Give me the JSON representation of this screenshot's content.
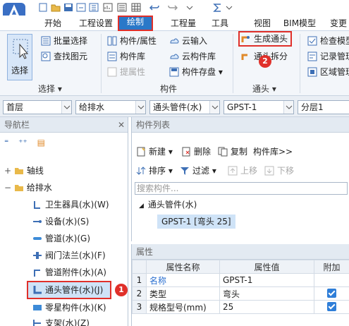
{
  "tabs": [
    {
      "label": "开始"
    },
    {
      "label": "工程设置"
    },
    {
      "label": "绘制",
      "active": true
    },
    {
      "label": "工程量"
    },
    {
      "label": "工具"
    },
    {
      "label": "视图"
    },
    {
      "label": "BIM模型"
    },
    {
      "label": "变更"
    }
  ],
  "ribbon": {
    "select_label": "选择",
    "batch_select": "批量选择",
    "find_element": "查找图元",
    "group_select": "选择",
    "component_attr": "构件/属性",
    "component_lib": "构件库",
    "extract_attr": "提属性",
    "cloud_input": "云输入",
    "cloud_lib": "云构件库",
    "component_save": "构件存盘",
    "group_component": "构件",
    "generate_fitting": "生成通头",
    "fitting_split": "通头拆分",
    "group_fitting": "通头",
    "check_model": "检查模型",
    "record_manage": "记录管理",
    "area_manage": "区域管理"
  },
  "dropdowns": {
    "floor": "首层",
    "discipline": "给排水",
    "type": "通头管件(水)",
    "component": "GPST-1",
    "layer": "分层1"
  },
  "nav": {
    "title": "导航栏",
    "axis": "轴线",
    "water": "给排水",
    "items": [
      {
        "label": "卫生器具(水)(W)"
      },
      {
        "label": "设备(水)(S)"
      },
      {
        "label": "管道(水)(G)"
      },
      {
        "label": "阀门法兰(水)(F)"
      },
      {
        "label": "管道附件(水)(A)"
      },
      {
        "label": "通头管件(水)(J)"
      },
      {
        "label": "零星构件(水)(K)"
      },
      {
        "label": "支架(水)(Z)"
      }
    ]
  },
  "list": {
    "title": "构件列表",
    "new": "新建",
    "delete": "删除",
    "copy": "复制",
    "library": "构件库>>",
    "sort": "排序",
    "filter": "过滤",
    "up": "上移",
    "down": "下移",
    "search_placeholder": "搜索构件...",
    "group": "通头管件(水)",
    "selected_item": "GPST-1 [弯头 25]"
  },
  "props": {
    "title": "属性",
    "col_name": "属性名称",
    "col_value": "属性值",
    "col_extra": "附加",
    "rows": [
      {
        "idx": "1",
        "name": "名称",
        "value": "GPST-1"
      },
      {
        "idx": "2",
        "name": "类型",
        "value": "弯头"
      },
      {
        "idx": "3",
        "name": "规格型号(mm)",
        "value": "25"
      }
    ]
  },
  "badges": {
    "one": "1",
    "two": "2"
  },
  "colors": {
    "accent": "#2a78c8",
    "highlight": "#e0302a",
    "check": "#2f7ed8"
  }
}
